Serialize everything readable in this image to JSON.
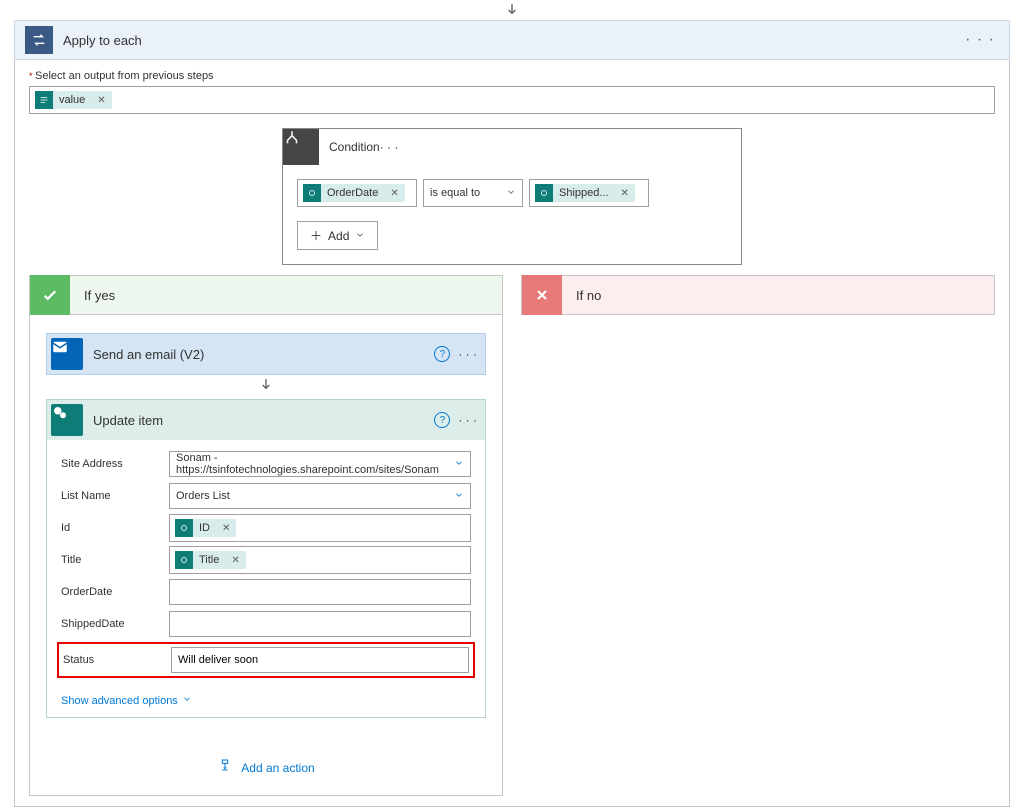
{
  "apply": {
    "title": "Apply to each",
    "outputLabel": "Select an output from previous steps",
    "token": "value"
  },
  "condition": {
    "title": "Condition",
    "left": "OrderDate",
    "op": "is equal to",
    "right": "Shipped...",
    "addLabel": "Add"
  },
  "branches": {
    "yes": "If yes",
    "no": "If no"
  },
  "email": {
    "title": "Send an email (V2)"
  },
  "update": {
    "title": "Update item",
    "fields": {
      "siteLabel": "Site Address",
      "siteValue": "Sonam - https://tsinfotechnologies.sharepoint.com/sites/Sonam",
      "listLabel": "List Name",
      "listValue": "Orders List",
      "idLabel": "Id",
      "idToken": "ID",
      "titleLabel": "Title",
      "titleToken": "Title",
      "orderDateLabel": "OrderDate",
      "shippedDateLabel": "ShippedDate",
      "statusLabel": "Status",
      "statusValue": "Will deliver soon"
    },
    "advanced": "Show advanced options"
  },
  "addAction": "Add an action"
}
